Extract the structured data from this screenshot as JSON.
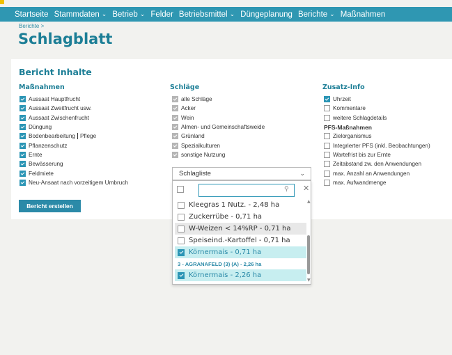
{
  "nav": {
    "items": [
      {
        "label": "Startseite",
        "dropdown": false
      },
      {
        "label": "Stammdaten",
        "dropdown": true
      },
      {
        "label": "Betrieb",
        "dropdown": true
      },
      {
        "label": "Felder",
        "dropdown": false
      },
      {
        "label": "Betriebsmittel",
        "dropdown": true
      },
      {
        "label": "Düngeplanung",
        "dropdown": false
      },
      {
        "label": "Berichte",
        "dropdown": true
      },
      {
        "label": "Maßnahmen",
        "dropdown": false
      }
    ]
  },
  "breadcrumb": "Berichte >",
  "page_title": "Schlagblatt",
  "report": {
    "title": "Bericht Inhalte",
    "massnahmen": {
      "title": "Maßnahmen",
      "items": [
        {
          "label": "Aussaat Hauptfrucht",
          "checked": true
        },
        {
          "label": "Aussaat Zweitfrucht usw.",
          "checked": true
        },
        {
          "label": "Aussaat Zwischenfrucht",
          "checked": true
        },
        {
          "label": "Düngung",
          "checked": true
        },
        {
          "label": "Bodenbearbeitung",
          "label2": "Pflege",
          "checked": true
        },
        {
          "label": "Pflanzenschutz",
          "checked": true
        },
        {
          "label": "Ernte",
          "checked": true
        },
        {
          "label": "Bewässerung",
          "checked": true
        },
        {
          "label": "Feldmiete",
          "checked": true
        },
        {
          "label": "Neu-Ansaat nach vorzeitigem Umbruch",
          "checked": true
        }
      ]
    },
    "schlaege": {
      "title": "Schläge",
      "items": [
        {
          "label": "alle Schläge",
          "checked": true
        },
        {
          "label": "Acker",
          "checked": true
        },
        {
          "label": "Wein",
          "checked": true
        },
        {
          "label": "Almen- und Gemeinschaftsweide",
          "checked": true
        },
        {
          "label": "Grünland",
          "checked": true
        },
        {
          "label": "Spezialkulturen",
          "checked": true
        },
        {
          "label": "sonstige Nutzung",
          "checked": true
        }
      ]
    },
    "zusatz": {
      "title": "Zusatz-Info",
      "items": [
        {
          "label": "Uhrzeit",
          "checked": true
        },
        {
          "label": "Kommentare",
          "checked": false
        },
        {
          "label": "weitere Schlagdetails",
          "checked": false
        }
      ],
      "pfs_title": "PFS-Maßnahmen",
      "pfs_items": [
        {
          "label": "Zielorganismus",
          "checked": false
        },
        {
          "label": "Integrierter PFS (inkl. Beobachtungen)",
          "checked": false
        },
        {
          "label": "Wartefrist bis zur Ernte",
          "checked": false
        },
        {
          "label": "Zeitabstand zw. den Anwendungen",
          "checked": false
        },
        {
          "label": "max. Anzahl an Anwendungen",
          "checked": false
        },
        {
          "label": "max. Aufwandmenge",
          "checked": false
        }
      ]
    },
    "button_label": "Bericht erstellen"
  },
  "schlagliste": {
    "label": "Schlagliste",
    "search_value": "",
    "rows": [
      {
        "label": "Kleegras 1 Nutz. - 2,48 ha",
        "checked": false
      },
      {
        "label": "Zuckerrübe - 0,71 ha",
        "checked": false
      },
      {
        "label": "W-Weizen < 14%RP - 0,71 ha",
        "checked": false,
        "hover": true
      },
      {
        "label": "Speiseind.-Kartoffel - 0,71 ha",
        "checked": false
      },
      {
        "label": "Körnermais - 0,71 ha",
        "checked": true
      },
      {
        "group": "3 - AGRANAFELD (3) (A) - 2,26 ha"
      },
      {
        "label": "Körnermais - 2,26 ha",
        "checked": true
      }
    ]
  },
  "colors": {
    "nav": "#2f97b2",
    "accent": "#1c7e96",
    "checkbox": "#2b95b5"
  }
}
